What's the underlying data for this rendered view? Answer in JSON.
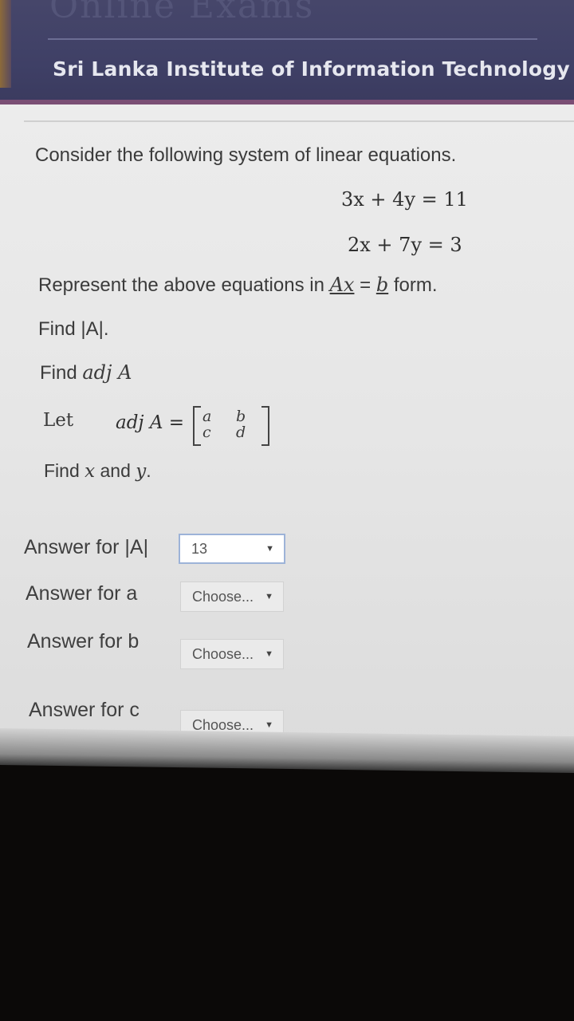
{
  "header": {
    "site_title": "Online Exams",
    "institute": "Sri Lanka Institute of Information Technology"
  },
  "question": {
    "intro": "Consider the following system of linear equations.",
    "equation_1": "3x + 4y = 11",
    "equation_2": "2x + 7y = 3",
    "represent_prefix": "Represent the above equations in ",
    "represent_ax": "Ax",
    "represent_eq": " = ",
    "represent_b": "b",
    "represent_suffix": " form.",
    "find_det": "Find |A|.",
    "find_adj_prefix": "Find ",
    "find_adj_math": "adj A",
    "let_label": "Let",
    "adj_label": "adj A =",
    "matrix": {
      "a": "a",
      "b": "b",
      "c": "c",
      "d": "d"
    },
    "find_xy_prefix": "Find ",
    "find_xy_x": "x",
    "find_xy_and": " and ",
    "find_xy_y": "y",
    "find_xy_suffix": "."
  },
  "answers": [
    {
      "label": "Answer for |A|",
      "value": "13",
      "arrow": "▼"
    },
    {
      "label": "Answer for a",
      "value": "Choose...",
      "arrow": "▼"
    },
    {
      "label": "Answer for b",
      "value": "Choose...",
      "arrow": "▼"
    },
    {
      "label": "Answer for c",
      "value": "Choose...",
      "arrow": "▼"
    }
  ]
}
